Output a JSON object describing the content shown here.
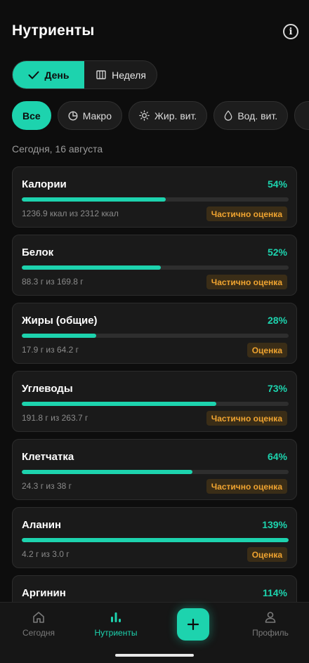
{
  "header": {
    "title": "Нутриенты"
  },
  "period_toggle": {
    "day": "День",
    "week": "Неделя"
  },
  "filters": [
    {
      "label": "Все",
      "icon": "none",
      "active": true
    },
    {
      "label": "Макро",
      "icon": "pie-chart-icon",
      "active": false
    },
    {
      "label": "Жир. вит.",
      "icon": "sun-icon",
      "active": false
    },
    {
      "label": "Вод. вит.",
      "icon": "droplet-icon",
      "active": false
    }
  ],
  "date_label": "Сегодня, 16 августа",
  "nutrients": [
    {
      "name": "Калории",
      "percent_label": "54%",
      "percent": 54,
      "amount": "1236.9 ккал из 2312 ккал",
      "badge": "Частично оценка"
    },
    {
      "name": "Белок",
      "percent_label": "52%",
      "percent": 52,
      "amount": "88.3 г из 169.8 г",
      "badge": "Частично оценка"
    },
    {
      "name": "Жиры (общие)",
      "percent_label": "28%",
      "percent": 28,
      "amount": "17.9 г из 64.2 г",
      "badge": "Оценка"
    },
    {
      "name": "Углеводы",
      "percent_label": "73%",
      "percent": 73,
      "amount": "191.8 г из 263.7 г",
      "badge": "Частично оценка"
    },
    {
      "name": "Клетчатка",
      "percent_label": "64%",
      "percent": 64,
      "amount": "24.3 г из 38 г",
      "badge": "Частично оценка"
    },
    {
      "name": "Аланин",
      "percent_label": "139%",
      "percent": 139,
      "amount": "4.2 г из 3.0 г",
      "badge": "Оценка"
    },
    {
      "name": "Аргинин",
      "percent_label": "114%",
      "percent": 114,
      "amount": "",
      "badge": ""
    }
  ],
  "nav": {
    "today": "Сегодня",
    "nutrients": "Нутриенты",
    "profile": "Профиль"
  },
  "colors": {
    "accent": "#1dd3ae",
    "badge_text": "#f0a430",
    "background": "#0d0d0d"
  }
}
